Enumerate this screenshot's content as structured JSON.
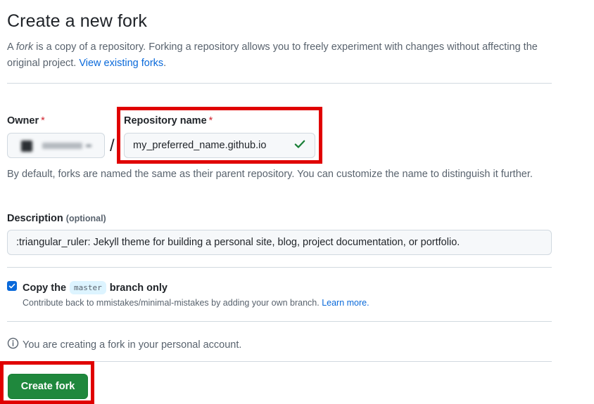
{
  "page": {
    "title": "Create a new fork",
    "intro": {
      "prefix": "A ",
      "fork_word": "fork",
      "suffix": " is a copy of a repository. Forking a repository allows you to freely experiment with changes without affecting the original project. ",
      "link": "View existing forks",
      "end": "."
    }
  },
  "owner": {
    "label": "Owner",
    "required_mark": "*"
  },
  "separator": "/",
  "repository": {
    "label": "Repository name",
    "required_mark": "*",
    "value": "my_preferred_name.github.io",
    "valid_icon": "check-icon",
    "hint": "By default, forks are named the same as their parent repository. You can customize the name to distinguish it further."
  },
  "description": {
    "label": "Description",
    "optional": "(optional)",
    "value": ":triangular_ruler: Jekyll theme for building a personal site, blog, project documentation, or portfolio."
  },
  "copy_branch": {
    "checked": true,
    "label_prefix": "Copy the",
    "branch": "master",
    "label_suffix": "branch only",
    "help_text": "Contribute back to mmistakes/minimal-mistakes by adding your own branch.",
    "help_link": "Learn more."
  },
  "notice": {
    "icon": "info-icon",
    "text": "You are creating a fork in your personal account."
  },
  "submit": {
    "label": "Create fork"
  },
  "colors": {
    "primary_button": "#1f883d",
    "link": "#0969da",
    "annotation_highlight": "#e00000",
    "required": "#d1242f",
    "check": "#1a7f37"
  }
}
